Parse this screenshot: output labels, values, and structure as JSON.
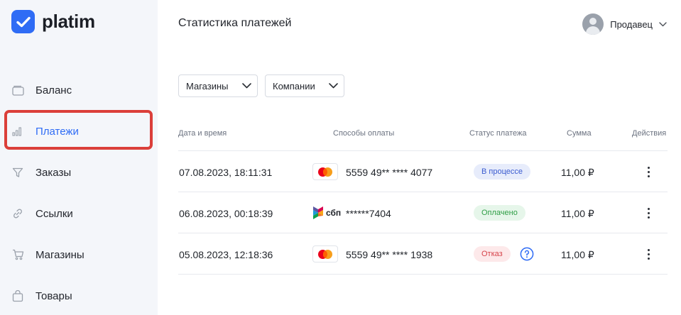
{
  "brand": {
    "name": "platim",
    "accent": "#2f6cf5"
  },
  "sidebar": {
    "items": [
      {
        "label": "Баланс",
        "icon": "wallet-icon",
        "active": false
      },
      {
        "label": "Платежи",
        "icon": "bar-chart-icon",
        "active": true
      },
      {
        "label": "Заказы",
        "icon": "filter-icon",
        "active": false
      },
      {
        "label": "Ссылки",
        "icon": "link-icon",
        "active": false
      },
      {
        "label": "Магазины",
        "icon": "cart-icon",
        "active": false
      },
      {
        "label": "Товары",
        "icon": "bag-icon",
        "active": false
      }
    ]
  },
  "header": {
    "title": "Статистика платежей",
    "user": {
      "name": "Продавец",
      "icon": "chevron-down-icon"
    }
  },
  "filters": {
    "shops": "Магазины",
    "companies": "Компании"
  },
  "table": {
    "columns": [
      "Дата и время",
      "Способы оплаты",
      "Статус платежа",
      "Сумма",
      "Действия"
    ],
    "rows": [
      {
        "datetime": "07.08.2023, 18:11:31",
        "method": "mastercard-icon",
        "account": "5559 49** **** 4077",
        "status": "В процессе",
        "status_kind": "progress",
        "amount": "11,00 ₽"
      },
      {
        "datetime": "06.08.2023, 00:18:39",
        "method": "sbp-icon",
        "method_label": "сбп",
        "account": "******7404",
        "status": "Оплачено",
        "status_kind": "paid",
        "amount": "11,00 ₽"
      },
      {
        "datetime": "05.08.2023, 12:18:36",
        "method": "mastercard-icon",
        "account": "5559 49** **** 1938",
        "status": "Отказ",
        "status_kind": "refused",
        "amount": "11,00 ₽",
        "help_icon": "question-circle-icon"
      }
    ]
  },
  "colors": {
    "progress": "#3a5bd0",
    "paid": "#2e9e45",
    "refused": "#d6434a",
    "highlight_frame": "#db3f3a"
  }
}
